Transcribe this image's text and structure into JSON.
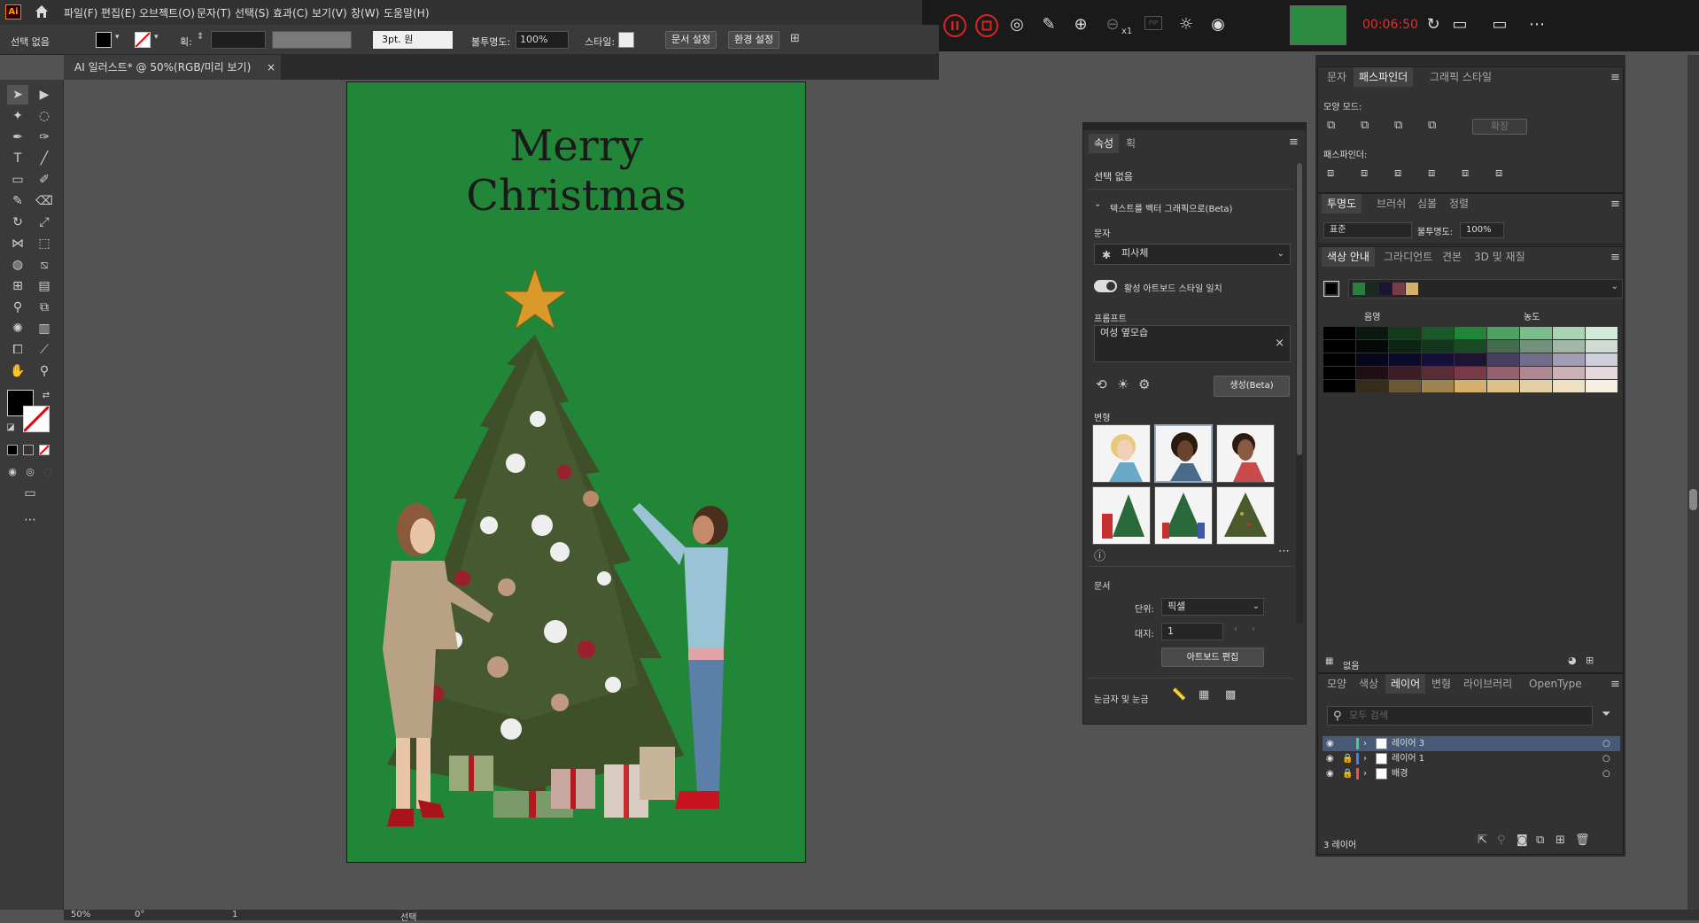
{
  "app": {
    "logo": "Ai"
  },
  "menu": [
    "파일(F)",
    "편집(E)",
    "오브젝트(O)",
    "문자(T)",
    "선택(S)",
    "효과(C)",
    "보기(V)",
    "창(W)",
    "도움말(H)"
  ],
  "recorder": {
    "timer": "00:06:50",
    "zoom_level": "x1",
    "pip": "PIP"
  },
  "control": {
    "selection": "선택 없음",
    "stroke_label": "획:",
    "brush": "3pt. 원",
    "opacity_label": "불투명도:",
    "opacity": "100%",
    "style_label": "스타일:",
    "doc_setup": "문서 설정",
    "prefs": "환경 설정"
  },
  "document_tab": {
    "title": "AI 일러스트* @ 50%(RGB/미리 보기)",
    "close": "×"
  },
  "artboard": {
    "line1": "Merry",
    "line2": "Christmas",
    "bg_color": "#228638"
  },
  "properties_panel": {
    "tabs": [
      "속성",
      "획"
    ],
    "selection": "선택 없음",
    "vectorize": "텍스트를 벡터 그래픽으로(Beta)",
    "subject_label": "문자",
    "subject_value": "피사체",
    "match_style": "활성 아트보드 스타일 일치",
    "prompt_label": "프롬프트",
    "prompt_value": "여성 옆모습",
    "generate": "생성(Beta)",
    "variations_label": "변형",
    "document_label": "문서",
    "units_label": "단위:",
    "units_value": "픽셀",
    "artboard_label": "대지:",
    "artboard_value": "1",
    "edit_artboards": "아트보드 편집",
    "rulers_grids": "눈금자 및 눈금"
  },
  "pathfinder_panel": {
    "tabs": [
      "문자",
      "패스파인더",
      "그래픽 스타일"
    ],
    "shape_modes": "모양 모드:",
    "expand": "확장",
    "pathfinders": "패스파인더:"
  },
  "transparency_panel": {
    "tabs": [
      "투명도",
      "브러쉬",
      "심볼",
      "정렬"
    ],
    "blend": "표준",
    "opacity_label": "불투명도:",
    "opacity": "100%"
  },
  "color_guide_panel": {
    "tabs": [
      "색상 안내",
      "그라디언트",
      "견본",
      "3D 및 재질"
    ],
    "shade_label": "음영",
    "tint_label": "농도",
    "footer": "없음",
    "base_colors": [
      "#000000",
      "#2a7f3e",
      "#1a2a1e",
      "#1b1533",
      "#7a3a48",
      "#d4b06a"
    ],
    "grid_rows": [
      [
        "#000000",
        "#0b1a0f",
        "#123a1c",
        "#1a5a2a",
        "#228638",
        "#4ea363",
        "#7bbd8c",
        "#a8d4b3",
        "#d4ead9"
      ],
      [
        "#000000",
        "#040b06",
        "#0c2412",
        "#13351b",
        "#1a4a24",
        "#466c4f",
        "#74917b",
        "#a3b7a8",
        "#d1dbd3"
      ],
      [
        "#000000",
        "#07061a",
        "#0d0b2a",
        "#14103b",
        "#1b1533",
        "#463f5f",
        "#726d8b",
        "#a19db6",
        "#d0cedb"
      ],
      [
        "#000000",
        "#1f0f12",
        "#3d1d24",
        "#5b2c36",
        "#7a3a48",
        "#95616d",
        "#b08891",
        "#cbb0b6",
        "#e6d7da"
      ],
      [
        "#000000",
        "#352c1a",
        "#6a5835",
        "#9f844f",
        "#d4b06a",
        "#ddc088",
        "#e5d0a6",
        "#eee0c3",
        "#f6efe1"
      ]
    ]
  },
  "layers_panel": {
    "tabs": [
      "모양",
      "색상",
      "레이어",
      "변형",
      "라이브러리",
      "OpenType"
    ],
    "search_placeholder": "모두 검색",
    "layers": [
      {
        "name": "레이어 3",
        "color": "#4ad37a",
        "locked": false
      },
      {
        "name": "레이어 1",
        "color": "#4a7bff",
        "locked": true
      },
      {
        "name": "배경",
        "color": "#ff4a4a",
        "locked": true
      }
    ],
    "count": "3 레이어"
  },
  "status": {
    "zoom": "50%",
    "rotation": "0°",
    "artboard": "1",
    "mode": "선택"
  }
}
